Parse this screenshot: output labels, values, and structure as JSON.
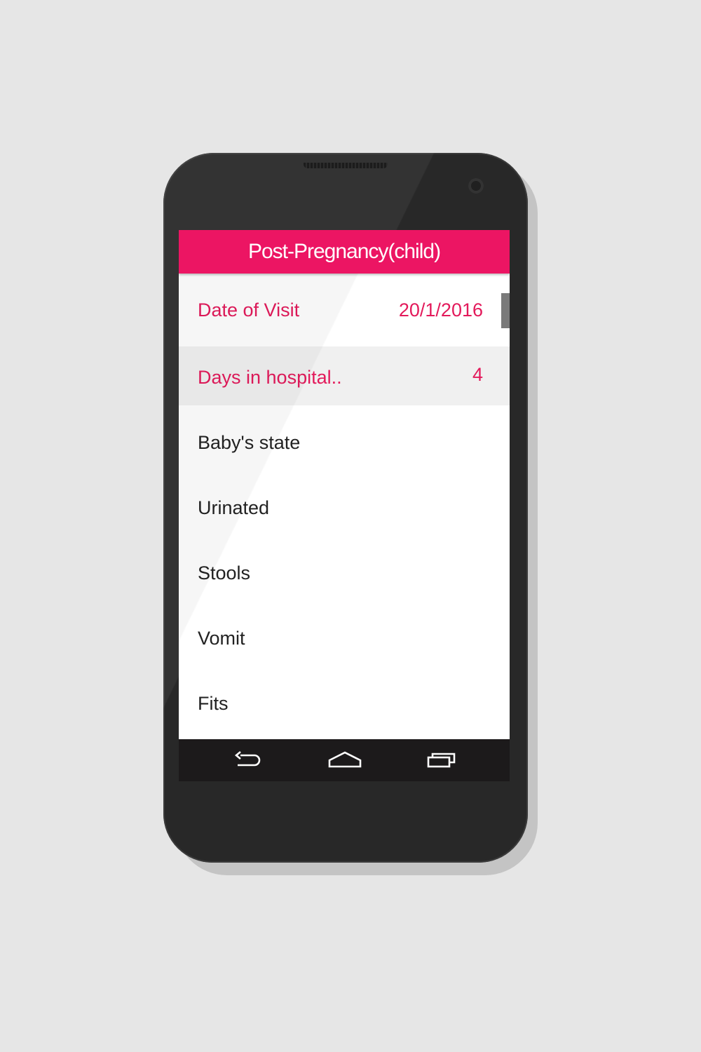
{
  "app_bar": {
    "title": "Post-Pregnancy(child)"
  },
  "rows": [
    {
      "label": "Date of Visit",
      "value": "20/1/2016"
    },
    {
      "label": "Days in hospital..",
      "value": "4"
    },
    {
      "label": "Baby's state",
      "value": ""
    },
    {
      "label": "Urinated",
      "value": ""
    },
    {
      "label": "Stools",
      "value": ""
    },
    {
      "label": "Vomit",
      "value": ""
    },
    {
      "label": "Fits",
      "value": ""
    }
  ],
  "nav": {
    "back_icon": "back-arrow-icon",
    "home_icon": "home-icon",
    "recents_icon": "recent-apps-icon"
  },
  "colors": {
    "accent": "#ec1563",
    "accent_text": "#e31a5b",
    "background": "#e6e6e6",
    "phone_body": "#282828",
    "nav_bar": "#1c1a1b"
  }
}
